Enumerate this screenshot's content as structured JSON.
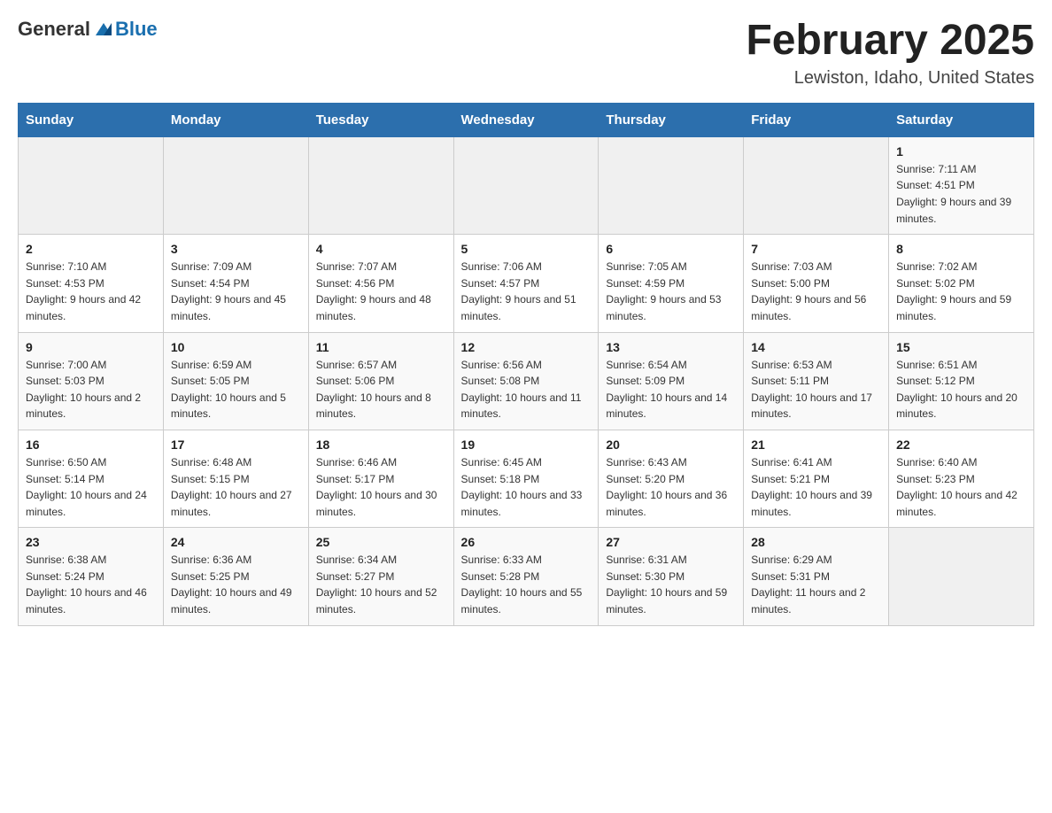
{
  "header": {
    "logo": {
      "general": "General",
      "blue": "Blue"
    },
    "title": "February 2025",
    "location": "Lewiston, Idaho, United States"
  },
  "days_of_week": [
    "Sunday",
    "Monday",
    "Tuesday",
    "Wednesday",
    "Thursday",
    "Friday",
    "Saturday"
  ],
  "weeks": [
    {
      "days": [
        {
          "number": "",
          "info": ""
        },
        {
          "number": "",
          "info": ""
        },
        {
          "number": "",
          "info": ""
        },
        {
          "number": "",
          "info": ""
        },
        {
          "number": "",
          "info": ""
        },
        {
          "number": "",
          "info": ""
        },
        {
          "number": "1",
          "info": "Sunrise: 7:11 AM\nSunset: 4:51 PM\nDaylight: 9 hours and 39 minutes."
        }
      ]
    },
    {
      "days": [
        {
          "number": "2",
          "info": "Sunrise: 7:10 AM\nSunset: 4:53 PM\nDaylight: 9 hours and 42 minutes."
        },
        {
          "number": "3",
          "info": "Sunrise: 7:09 AM\nSunset: 4:54 PM\nDaylight: 9 hours and 45 minutes."
        },
        {
          "number": "4",
          "info": "Sunrise: 7:07 AM\nSunset: 4:56 PM\nDaylight: 9 hours and 48 minutes."
        },
        {
          "number": "5",
          "info": "Sunrise: 7:06 AM\nSunset: 4:57 PM\nDaylight: 9 hours and 51 minutes."
        },
        {
          "number": "6",
          "info": "Sunrise: 7:05 AM\nSunset: 4:59 PM\nDaylight: 9 hours and 53 minutes."
        },
        {
          "number": "7",
          "info": "Sunrise: 7:03 AM\nSunset: 5:00 PM\nDaylight: 9 hours and 56 minutes."
        },
        {
          "number": "8",
          "info": "Sunrise: 7:02 AM\nSunset: 5:02 PM\nDaylight: 9 hours and 59 minutes."
        }
      ]
    },
    {
      "days": [
        {
          "number": "9",
          "info": "Sunrise: 7:00 AM\nSunset: 5:03 PM\nDaylight: 10 hours and 2 minutes."
        },
        {
          "number": "10",
          "info": "Sunrise: 6:59 AM\nSunset: 5:05 PM\nDaylight: 10 hours and 5 minutes."
        },
        {
          "number": "11",
          "info": "Sunrise: 6:57 AM\nSunset: 5:06 PM\nDaylight: 10 hours and 8 minutes."
        },
        {
          "number": "12",
          "info": "Sunrise: 6:56 AM\nSunset: 5:08 PM\nDaylight: 10 hours and 11 minutes."
        },
        {
          "number": "13",
          "info": "Sunrise: 6:54 AM\nSunset: 5:09 PM\nDaylight: 10 hours and 14 minutes."
        },
        {
          "number": "14",
          "info": "Sunrise: 6:53 AM\nSunset: 5:11 PM\nDaylight: 10 hours and 17 minutes."
        },
        {
          "number": "15",
          "info": "Sunrise: 6:51 AM\nSunset: 5:12 PM\nDaylight: 10 hours and 20 minutes."
        }
      ]
    },
    {
      "days": [
        {
          "number": "16",
          "info": "Sunrise: 6:50 AM\nSunset: 5:14 PM\nDaylight: 10 hours and 24 minutes."
        },
        {
          "number": "17",
          "info": "Sunrise: 6:48 AM\nSunset: 5:15 PM\nDaylight: 10 hours and 27 minutes."
        },
        {
          "number": "18",
          "info": "Sunrise: 6:46 AM\nSunset: 5:17 PM\nDaylight: 10 hours and 30 minutes."
        },
        {
          "number": "19",
          "info": "Sunrise: 6:45 AM\nSunset: 5:18 PM\nDaylight: 10 hours and 33 minutes."
        },
        {
          "number": "20",
          "info": "Sunrise: 6:43 AM\nSunset: 5:20 PM\nDaylight: 10 hours and 36 minutes."
        },
        {
          "number": "21",
          "info": "Sunrise: 6:41 AM\nSunset: 5:21 PM\nDaylight: 10 hours and 39 minutes."
        },
        {
          "number": "22",
          "info": "Sunrise: 6:40 AM\nSunset: 5:23 PM\nDaylight: 10 hours and 42 minutes."
        }
      ]
    },
    {
      "days": [
        {
          "number": "23",
          "info": "Sunrise: 6:38 AM\nSunset: 5:24 PM\nDaylight: 10 hours and 46 minutes."
        },
        {
          "number": "24",
          "info": "Sunrise: 6:36 AM\nSunset: 5:25 PM\nDaylight: 10 hours and 49 minutes."
        },
        {
          "number": "25",
          "info": "Sunrise: 6:34 AM\nSunset: 5:27 PM\nDaylight: 10 hours and 52 minutes."
        },
        {
          "number": "26",
          "info": "Sunrise: 6:33 AM\nSunset: 5:28 PM\nDaylight: 10 hours and 55 minutes."
        },
        {
          "number": "27",
          "info": "Sunrise: 6:31 AM\nSunset: 5:30 PM\nDaylight: 10 hours and 59 minutes."
        },
        {
          "number": "28",
          "info": "Sunrise: 6:29 AM\nSunset: 5:31 PM\nDaylight: 11 hours and 2 minutes."
        },
        {
          "number": "",
          "info": ""
        }
      ]
    }
  ]
}
